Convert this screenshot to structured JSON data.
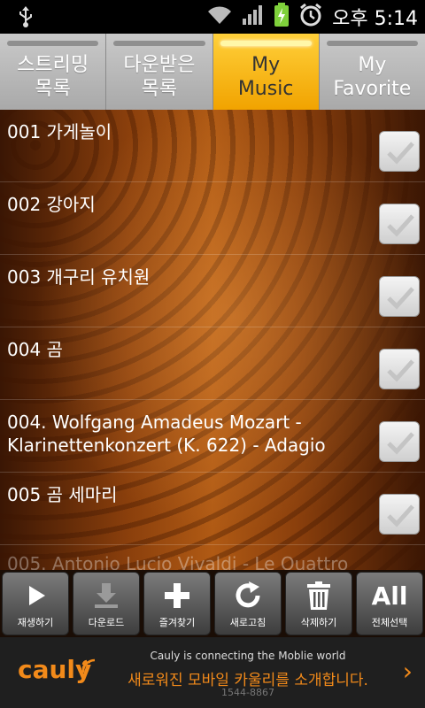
{
  "status_bar": {
    "clock": "오후 5:14",
    "icons": [
      "usb-icon",
      "wifi-icon",
      "signal-icon",
      "battery-charging-icon",
      "alarm-icon"
    ]
  },
  "tabs": [
    {
      "label": "스트리밍\n목록",
      "active": false
    },
    {
      "label": "다운받은\n목록",
      "active": false
    },
    {
      "label": "My\nMusic",
      "active": true
    },
    {
      "label": "My\nFavorite",
      "active": false
    }
  ],
  "list": {
    "items": [
      {
        "title": "001 가게놀이",
        "checked": false
      },
      {
        "title": "002 강아지",
        "checked": false
      },
      {
        "title": "003 개구리 유치원",
        "checked": false
      },
      {
        "title": "004 곰",
        "checked": false
      },
      {
        "title": "004. Wolfgang Amadeus Mozart - Klarinettenkonzert (K. 622) - Adagio",
        "checked": false
      },
      {
        "title": "005 곰 세마리",
        "checked": false
      },
      {
        "title": "005. Antonio Lucio Vivaldi - Le Quattro",
        "checked": false
      }
    ]
  },
  "toolbar": {
    "buttons": [
      {
        "label": "재생하기",
        "icon": "play-icon"
      },
      {
        "label": "다운로드",
        "icon": "download-icon"
      },
      {
        "label": "즐겨찾기",
        "icon": "plus-icon"
      },
      {
        "label": "새로고침",
        "icon": "refresh-icon"
      },
      {
        "label": "삭제하기",
        "icon": "trash-icon"
      },
      {
        "label": "전체선택",
        "icon": "select-all-icon",
        "glyph": "All"
      }
    ]
  },
  "ad": {
    "logo": "cauly",
    "line1": "Cauly is connecting the Moblie world",
    "line2": "새로워진 모바일 카울리를 소개합니다.",
    "line3": "1544-8867",
    "arrow": "›"
  },
  "colors": {
    "active_tab": "#f6b81a",
    "accent": "#f28a1a"
  }
}
